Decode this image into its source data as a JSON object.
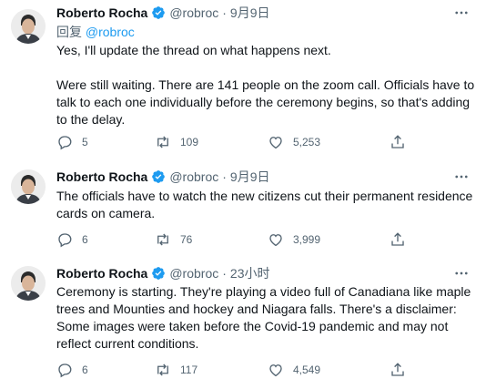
{
  "tweets": [
    {
      "author_name": "Roberto Rocha",
      "handle": "@robroc",
      "time_sep": "·",
      "time": "9月9日",
      "reply_prefix": "回复",
      "reply_handle": "@robroc",
      "text": "Yes, I'll update the thread on what happens next.\n\nWere still waiting. There are 141 people on the zoom call. Officials have to talk to each one individually before the ceremony begins, so that's adding to the delay.",
      "replies": "5",
      "retweets": "109",
      "likes": "5,253"
    },
    {
      "author_name": "Roberto Rocha",
      "handle": "@robroc",
      "time_sep": "·",
      "time": "9月9日",
      "text": "The officials have to watch the new citizens cut their permanent residence cards on camera.",
      "replies": "6",
      "retweets": "76",
      "likes": "3,999"
    },
    {
      "author_name": "Roberto Rocha",
      "handle": "@robroc",
      "time_sep": "·",
      "time": "23小时",
      "text": "Ceremony is starting. They're playing a video full of Canadiana like maple trees and Mounties and hockey and Niagara falls. There's a disclaimer: Some images were taken before the Covid-19 pandemic and may not reflect current conditions.",
      "replies": "6",
      "retweets": "117",
      "likes": "4,549"
    }
  ],
  "icons": {
    "verified": "verified-badge-icon",
    "more": "more-options-icon",
    "reply": "reply-icon",
    "retweet": "retweet-icon",
    "like": "like-icon",
    "share": "share-icon"
  },
  "colors": {
    "verified_blue": "#1d9bf0",
    "secondary_text": "#536471",
    "primary_text": "#0f1419"
  }
}
